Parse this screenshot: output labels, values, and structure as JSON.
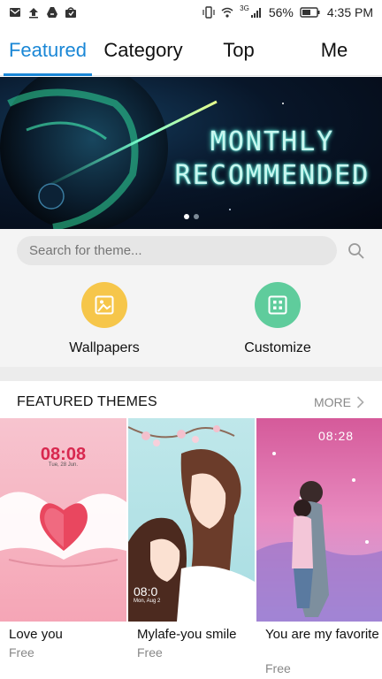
{
  "status_bar": {
    "battery_percent": "56%",
    "time": "4:35 PM",
    "network_label": "3G"
  },
  "tabs": [
    {
      "label": "Featured",
      "active": true
    },
    {
      "label": "Category",
      "active": false
    },
    {
      "label": "Top",
      "active": false
    },
    {
      "label": "Me",
      "active": false
    }
  ],
  "banner": {
    "line1": "MONTHLY",
    "line2": "RECOMMENDED",
    "page_count": 2,
    "active_page": 1
  },
  "search": {
    "placeholder": "Search for theme..."
  },
  "quick_entries": [
    {
      "label": "Wallpapers",
      "icon": "image-icon",
      "color": "#f6c64a"
    },
    {
      "label": "Customize",
      "icon": "grid-icon",
      "color": "#5fcc9c"
    }
  ],
  "featured": {
    "title": "FEATURED THEMES",
    "more_label": "MORE",
    "items": [
      {
        "name": "Love you",
        "price": "Free",
        "clock": "08:08",
        "date": "Tue, 28 Jun."
      },
      {
        "name": "Mylafe-you smile",
        "price": "Free",
        "clock": "08:0",
        "date": "Mon, Aug 2"
      },
      {
        "name": "You are my favorite",
        "price": "Free",
        "clock": "08:28",
        "date": ""
      }
    ]
  },
  "colors": {
    "accent": "#1a87d6",
    "wallpapers": "#f6c64a",
    "customize": "#5fcc9c"
  }
}
